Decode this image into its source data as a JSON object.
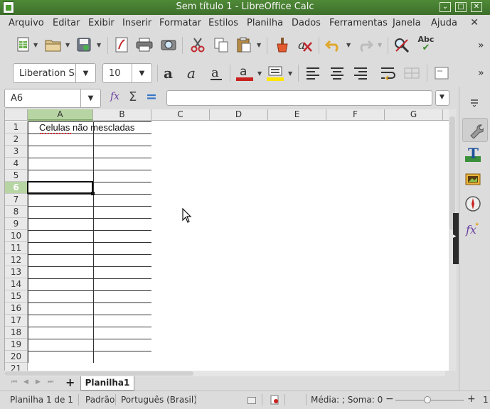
{
  "window": {
    "title": "Sem título 1 - LibreOffice Calc",
    "controls": [
      "⌄",
      "□",
      "✕"
    ]
  },
  "menu": {
    "items": [
      "Arquivo",
      "Editar",
      "Exibir",
      "Inserir",
      "Formatar",
      "Estilos",
      "Planilha",
      "Dados",
      "Ferramentas",
      "Janela",
      "Ajuda"
    ],
    "close": "✕"
  },
  "toolbar": {
    "font_name": "Liberation Sa",
    "font_size": "10",
    "spellcheck_label": "Abc",
    "more": "»"
  },
  "formula_bar": {
    "name_box": "A6",
    "fx": "fx",
    "sigma": "Σ",
    "equals": "=",
    "content": ""
  },
  "sheet": {
    "columns": [
      "A",
      "B",
      "C",
      "D",
      "E",
      "F",
      "G"
    ],
    "selected_column": "A",
    "rows": [
      "1",
      "2",
      "3",
      "4",
      "5",
      "6",
      "7",
      "8",
      "9",
      "10",
      "11",
      "12",
      "13",
      "14",
      "15",
      "16",
      "17",
      "18",
      "19",
      "20",
      "21"
    ],
    "selected_row": "6",
    "cell_A1": "Celulas não mescladas"
  },
  "tabs": {
    "add": "+",
    "active": "Planilha1",
    "nav": [
      "⏮",
      "◀",
      "▶",
      "⏭"
    ]
  },
  "status": {
    "sheet_info": "Planilha 1 de 1",
    "style": "Padrão",
    "language": "Português (Brasil)",
    "summary": "Média: ; Soma: 0",
    "zoom_minus": "−",
    "zoom_plus": "+",
    "zoom_level": "1"
  }
}
